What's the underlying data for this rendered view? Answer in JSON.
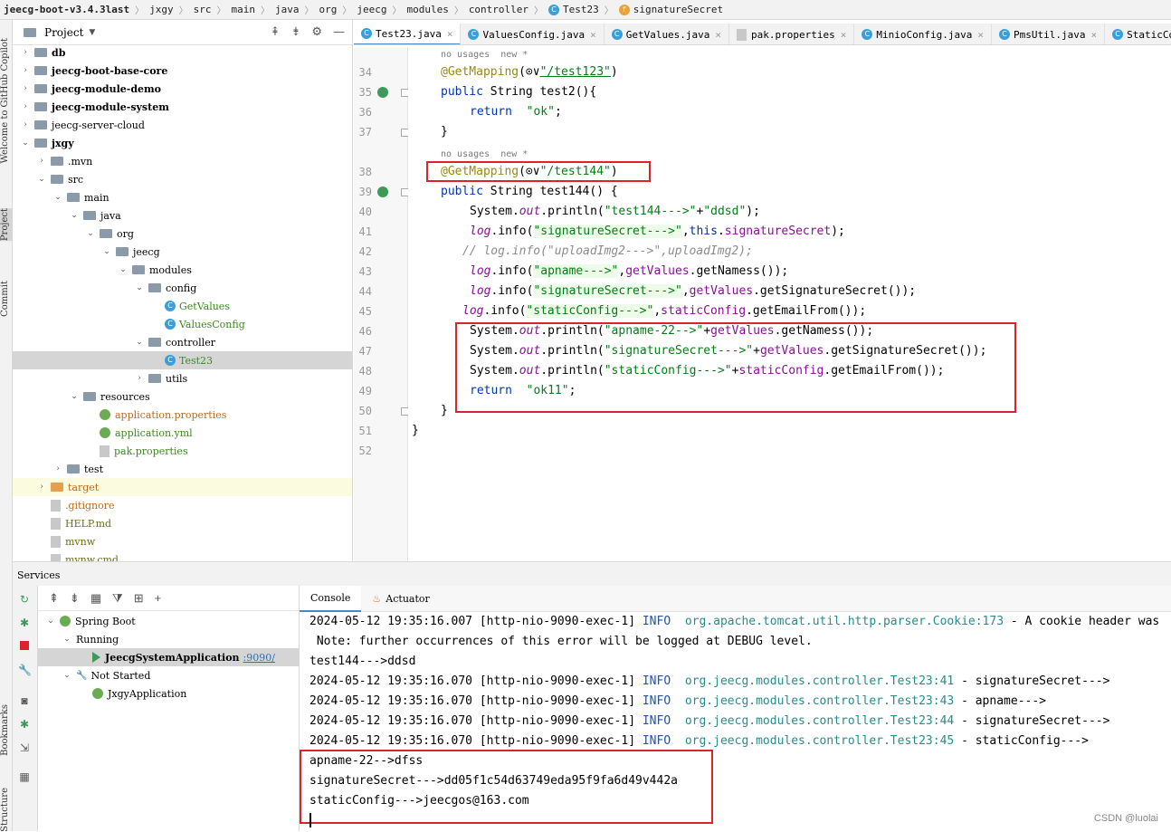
{
  "breadcrumb": [
    "jeecg-boot-v3.4.3last",
    "jxgy",
    "src",
    "main",
    "java",
    "org",
    "jeecg",
    "modules",
    "controller",
    "Test23",
    "signatureSecret"
  ],
  "left_strip": [
    "Welcome to GitHub Copilot",
    "Project",
    "Commit",
    "Bookmarks",
    "Structure"
  ],
  "project": {
    "title": "Project",
    "tree": [
      {
        "label": "db",
        "depth": 1,
        "arrow": ">",
        "icon": "folder",
        "style": "bold"
      },
      {
        "label": "jeecg-boot-base-core",
        "depth": 1,
        "arrow": ">",
        "icon": "folder",
        "style": "bold"
      },
      {
        "label": "jeecg-module-demo",
        "depth": 1,
        "arrow": ">",
        "icon": "folder",
        "style": "bold"
      },
      {
        "label": "jeecg-module-system",
        "depth": 1,
        "arrow": ">",
        "icon": "folder",
        "style": "bold"
      },
      {
        "label": "jeecg-server-cloud",
        "depth": 1,
        "arrow": ">",
        "icon": "folder",
        "style": ""
      },
      {
        "label": "jxgy",
        "depth": 1,
        "arrow": "v",
        "icon": "folder",
        "style": "bold"
      },
      {
        "label": ".mvn",
        "depth": 2,
        "arrow": ">",
        "icon": "folder",
        "style": ""
      },
      {
        "label": "src",
        "depth": 2,
        "arrow": "v",
        "icon": "folder",
        "style": ""
      },
      {
        "label": "main",
        "depth": 3,
        "arrow": "v",
        "icon": "folder",
        "style": ""
      },
      {
        "label": "java",
        "depth": 4,
        "arrow": "v",
        "icon": "folder",
        "style": ""
      },
      {
        "label": "org",
        "depth": 5,
        "arrow": "v",
        "icon": "folder",
        "style": ""
      },
      {
        "label": "jeecg",
        "depth": 6,
        "arrow": "v",
        "icon": "folder",
        "style": ""
      },
      {
        "label": "modules",
        "depth": 7,
        "arrow": "v",
        "icon": "folder",
        "style": ""
      },
      {
        "label": "config",
        "depth": 8,
        "arrow": "v",
        "icon": "folder",
        "style": ""
      },
      {
        "label": "GetValues",
        "depth": 9,
        "arrow": "",
        "icon": "class",
        "style": "green"
      },
      {
        "label": "ValuesConfig",
        "depth": 9,
        "arrow": "",
        "icon": "class",
        "style": "green"
      },
      {
        "label": "controller",
        "depth": 8,
        "arrow": "v",
        "icon": "folder",
        "style": ""
      },
      {
        "label": "Test23",
        "depth": 9,
        "arrow": "",
        "icon": "class",
        "style": "green",
        "selected": true
      },
      {
        "label": "utils",
        "depth": 8,
        "arrow": ">",
        "icon": "folder",
        "style": ""
      },
      {
        "label": "resources",
        "depth": 4,
        "arrow": "v",
        "icon": "folder",
        "style": ""
      },
      {
        "label": "application.properties",
        "depth": 5,
        "arrow": "",
        "icon": "gear",
        "style": "orangetxt"
      },
      {
        "label": "application.yml",
        "depth": 5,
        "arrow": "",
        "icon": "gear",
        "style": "green"
      },
      {
        "label": "pak.properties",
        "depth": 5,
        "arrow": "",
        "icon": "file",
        "style": "green"
      },
      {
        "label": "test",
        "depth": 3,
        "arrow": ">",
        "icon": "folder",
        "style": ""
      },
      {
        "label": "target",
        "depth": 2,
        "arrow": ">",
        "icon": "folder-orange",
        "style": "orangetxt",
        "highlight": true
      },
      {
        "label": ".gitignore",
        "depth": 2,
        "arrow": "",
        "icon": "file",
        "style": "orangetxt"
      },
      {
        "label": "HELP.md",
        "depth": 2,
        "arrow": "",
        "icon": "file",
        "style": "olive"
      },
      {
        "label": "mvnw",
        "depth": 2,
        "arrow": "",
        "icon": "file",
        "style": "olive"
      },
      {
        "label": "mvnw.cmd",
        "depth": 2,
        "arrow": "",
        "icon": "file",
        "style": "olive"
      }
    ]
  },
  "editor_tabs": [
    {
      "label": "Test23.java",
      "active": true
    },
    {
      "label": "ValuesConfig.java",
      "active": false
    },
    {
      "label": "GetValues.java",
      "active": false
    },
    {
      "label": "pak.properties",
      "active": false
    },
    {
      "label": "MinioConfig.java",
      "active": false
    },
    {
      "label": "PmsUtil.java",
      "active": false
    },
    {
      "label": "StaticConfig",
      "active": false
    }
  ],
  "code": {
    "hint_1": "no usages  new *",
    "hint_2": "no usages  new *",
    "lines": [
      {
        "n": "34",
        "parts": [
          [
            "ann",
            "@GetMapping"
          ],
          [
            "",
            "("
          ],
          [
            "",
            "⊙∨"
          ],
          [
            "urlstr",
            "\"/test123\""
          ],
          [
            "",
            ")"
          ]
        ],
        "indent": 32
      },
      {
        "n": "35",
        "parts": [
          [
            "kw",
            "public "
          ],
          [
            "",
            "String "
          ],
          [
            "",
            "test2(){"
          ]
        ],
        "indent": 32
      },
      {
        "n": "36",
        "parts": [
          [
            "kw",
            "return  "
          ],
          [
            "str",
            "\"ok\""
          ],
          [
            "",
            ";"
          ]
        ],
        "indent": 64
      },
      {
        "n": "37",
        "parts": [
          [
            "",
            "}"
          ]
        ],
        "indent": 32
      },
      {
        "n": "38",
        "parts": [
          [
            "ann",
            "@GetMapping"
          ],
          [
            "",
            "("
          ],
          [
            "",
            "⊙∨"
          ],
          [
            "str",
            "\"/test144\""
          ],
          [
            "",
            ")"
          ]
        ],
        "indent": 32
      },
      {
        "n": "39",
        "parts": [
          [
            "kw",
            "public "
          ],
          [
            "",
            "String "
          ],
          [
            "",
            "test144() {"
          ]
        ],
        "indent": 32
      },
      {
        "n": "40",
        "parts": [
          [
            "",
            "System."
          ],
          [
            "ital",
            "out"
          ],
          [
            "",
            ".println("
          ],
          [
            "str",
            "\"test144--->\""
          ],
          [
            "",
            "+"
          ],
          [
            "str",
            "\"ddsd\""
          ],
          [
            "",
            ");"
          ]
        ],
        "indent": 64
      },
      {
        "n": "41",
        "parts": [
          [
            "ital",
            "log"
          ],
          [
            "",
            ".info("
          ],
          [
            "strbg",
            "\"signatureSecret--->\""
          ],
          [
            "",
            ","
          ],
          [
            "kw",
            "this"
          ],
          [
            "",
            "."
          ],
          [
            "fld",
            "signatureSecret"
          ],
          [
            "",
            ");"
          ]
        ],
        "indent": 64
      },
      {
        "n": "42",
        "parts": [
          [
            "cmt",
            "// log.info(\"uploadImg2--->\",uploadImg2);"
          ]
        ],
        "indent": 56
      },
      {
        "n": "43",
        "parts": [
          [
            "ital",
            "log"
          ],
          [
            "",
            ".info("
          ],
          [
            "strbg",
            "\"apname--->\""
          ],
          [
            "",
            ","
          ],
          [
            "fld",
            "getValues"
          ],
          [
            "",
            ".getNamess());"
          ]
        ],
        "indent": 64
      },
      {
        "n": "44",
        "parts": [
          [
            "ital",
            "log"
          ],
          [
            "",
            ".info("
          ],
          [
            "strbg",
            "\"signatureSecret--->\""
          ],
          [
            "",
            ","
          ],
          [
            "fld",
            "getValues"
          ],
          [
            "",
            ".getSignatureSecret());"
          ]
        ],
        "indent": 64
      },
      {
        "n": "45",
        "parts": [
          [
            "ital",
            "log"
          ],
          [
            "",
            ".info("
          ],
          [
            "strbg",
            "\"staticConfig--->\""
          ],
          [
            "",
            ","
          ],
          [
            "fld",
            "staticConfig"
          ],
          [
            "",
            ".getEmailFrom());"
          ]
        ],
        "indent": 56
      },
      {
        "n": "46",
        "parts": [
          [
            "",
            "System."
          ],
          [
            "ital",
            "out"
          ],
          [
            "",
            ".println("
          ],
          [
            "str",
            "\"apname-22-->\""
          ],
          [
            "",
            "+"
          ],
          [
            "fld",
            "getValues"
          ],
          [
            "",
            ".getNamess());"
          ]
        ],
        "indent": 64
      },
      {
        "n": "47",
        "parts": [
          [
            "",
            "System."
          ],
          [
            "ital",
            "out"
          ],
          [
            "",
            ".println("
          ],
          [
            "str",
            "\"signatureSecret--->\""
          ],
          [
            "",
            "+"
          ],
          [
            "fld",
            "getValues"
          ],
          [
            "",
            ".getSignatureSecret());"
          ]
        ],
        "indent": 64
      },
      {
        "n": "48",
        "parts": [
          [
            "",
            "System."
          ],
          [
            "ital",
            "out"
          ],
          [
            "",
            ".println("
          ],
          [
            "str",
            "\"staticConfig--->\""
          ],
          [
            "",
            "+"
          ],
          [
            "fld",
            "staticConfig"
          ],
          [
            "",
            ".getEmailFrom());"
          ]
        ],
        "indent": 64
      },
      {
        "n": "49",
        "parts": [
          [
            "kw",
            "return  "
          ],
          [
            "str",
            "\"ok11\""
          ],
          [
            "",
            ";"
          ]
        ],
        "indent": 64
      },
      {
        "n": "50",
        "parts": [
          [
            "",
            "}"
          ]
        ],
        "indent": 32
      },
      {
        "n": "51",
        "parts": [
          [
            "",
            "}"
          ]
        ],
        "indent": 0
      },
      {
        "n": "52",
        "parts": [],
        "indent": 0
      }
    ]
  },
  "services": {
    "title": "Services",
    "tree": [
      {
        "label": "Spring Boot",
        "depth": 0,
        "arrow": "v",
        "icon": "spring"
      },
      {
        "label": "Running",
        "depth": 1,
        "arrow": "v",
        "icon": "none"
      },
      {
        "label": "JeecgSystemApplication",
        "port": ":9090/",
        "depth": 2,
        "arrow": "",
        "icon": "run",
        "selected": true
      },
      {
        "label": "Not Started",
        "depth": 1,
        "arrow": "v",
        "icon": "wrench"
      },
      {
        "label": "JxgyApplication",
        "depth": 2,
        "arrow": "",
        "icon": "spring"
      }
    ]
  },
  "console_tabs": [
    "Console",
    "Actuator"
  ],
  "console": {
    "lines": [
      {
        "ts": "2024-05-12 19:35:16.007 [http-nio-9090-exec-1] ",
        "level": "INFO",
        "logger": "  org.apache.tomcat.util.http.parser.Cookie:173",
        "msg": " - A cookie header was"
      },
      {
        "plain": " Note: further occurrences of this error will be logged at DEBUG level."
      },
      {
        "plain": "test144--->ddsd"
      },
      {
        "ts": "2024-05-12 19:35:16.070 [http-nio-9090-exec-1] ",
        "level": "INFO",
        "logger": "  org.jeecg.modules.controller.Test23:41",
        "msg": " - signatureSecret--->"
      },
      {
        "ts": "2024-05-12 19:35:16.070 [http-nio-9090-exec-1] ",
        "level": "INFO",
        "logger": "  org.jeecg.modules.controller.Test23:43",
        "msg": " - apname--->"
      },
      {
        "ts": "2024-05-12 19:35:16.070 [http-nio-9090-exec-1] ",
        "level": "INFO",
        "logger": "  org.jeecg.modules.controller.Test23:44",
        "msg": " - signatureSecret--->"
      },
      {
        "ts": "2024-05-12 19:35:16.070 [http-nio-9090-exec-1] ",
        "level": "INFO",
        "logger": "  org.jeecg.modules.controller.Test23:45",
        "msg": " - staticConfig--->"
      },
      {
        "plain": "apname-22-->dfss"
      },
      {
        "plain": "signatureSecret--->dd05f1c54d63749eda95f9fa6d49v442a"
      },
      {
        "plain": "staticConfig--->jeecgos@163.com"
      }
    ]
  },
  "watermark": "CSDN @luolai",
  "colors": {
    "highlight_box": "#d9232d",
    "accent": "#4a88c7",
    "keyword": "#0033b3",
    "string": "#067d17",
    "annotation": "#9e880d",
    "field": "#871094",
    "info": "#1a55b5",
    "logger": "#2a8b8b"
  }
}
